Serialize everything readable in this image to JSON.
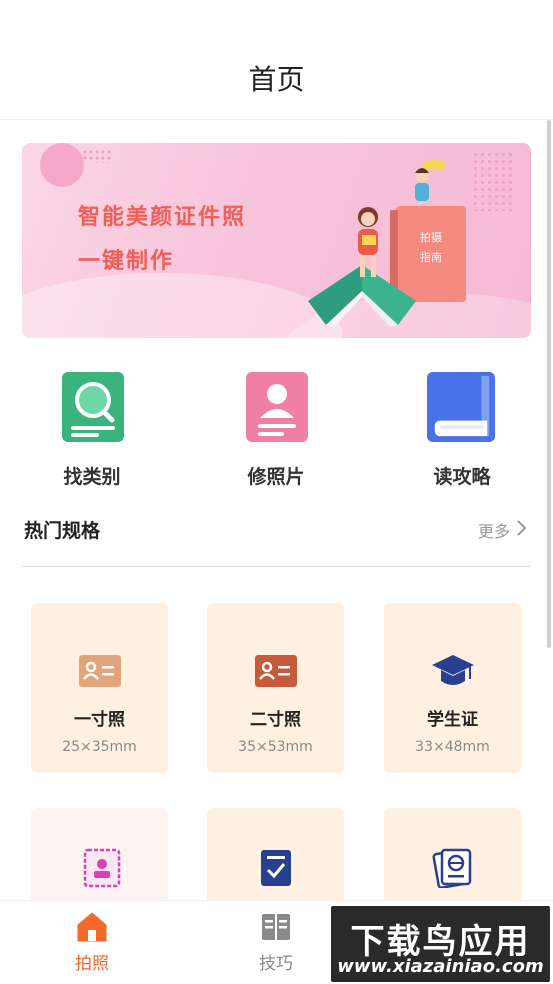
{
  "header": {
    "title": "首页"
  },
  "banner": {
    "line1": "智能美颜证件照",
    "line2": "一键制作",
    "book_label_1": "拍摄",
    "book_label_2": "指南"
  },
  "quick_actions": [
    {
      "label": "找类别",
      "icon": "search-category-icon",
      "color": "#3bb37d"
    },
    {
      "label": "修照片",
      "icon": "person-edit-icon",
      "color": "#f07fa6"
    },
    {
      "label": "读攻略",
      "icon": "book-icon",
      "color": "#4a72e8"
    }
  ],
  "hot_section": {
    "title": "热门规格",
    "more_label": "更多"
  },
  "specs": [
    {
      "name": "一寸照",
      "size": "25×35mm",
      "icon": "id-card-icon"
    },
    {
      "name": "二寸照",
      "size": "35×53mm",
      "icon": "id-card-icon"
    },
    {
      "name": "学生证",
      "size": "33×48mm",
      "icon": "graduation-cap-icon"
    },
    {
      "name": "",
      "size": "",
      "icon": "profile-doc-icon"
    },
    {
      "name": "",
      "size": "",
      "icon": "checklist-icon"
    },
    {
      "name": "",
      "size": "",
      "icon": "passport-icon"
    }
  ],
  "tabs": [
    {
      "label": "拍照",
      "icon": "home-icon",
      "active": true
    },
    {
      "label": "技巧",
      "icon": "article-icon",
      "active": false
    }
  ],
  "watermark": {
    "line1": "下载鸟应用",
    "line2": "www.xiazainiao.com"
  },
  "colors": {
    "accent": "#f26b2a",
    "banner_text": "#ee5f58",
    "card_bg": "#fef1e2",
    "tab_inactive": "#8a8a8a"
  }
}
